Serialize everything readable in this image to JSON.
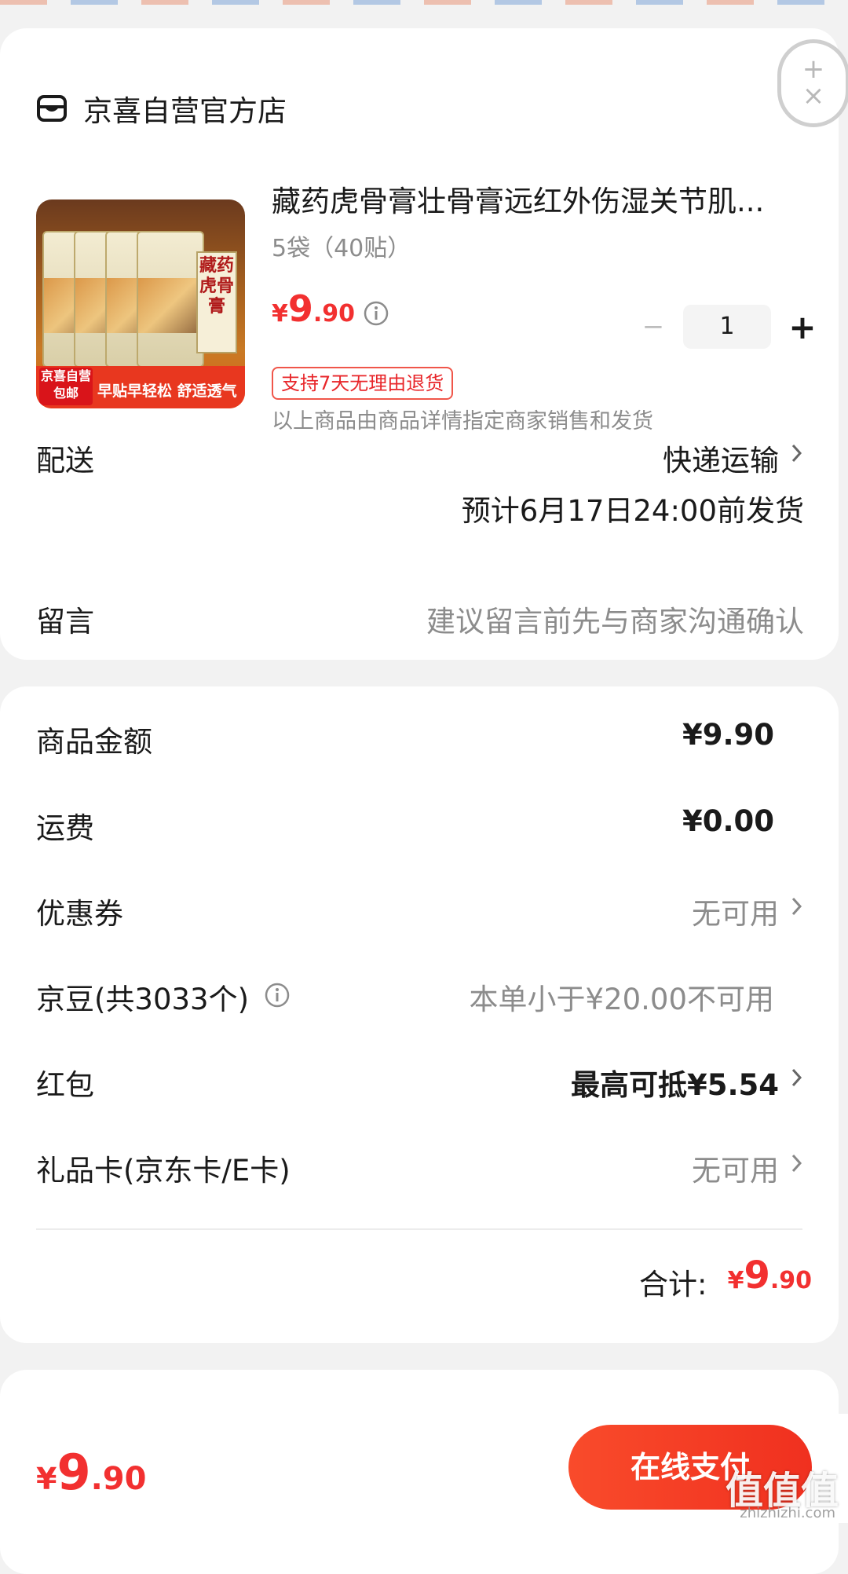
{
  "shop": {
    "name": "京喜自营官方店",
    "icon": "shop-icon"
  },
  "product": {
    "title": "藏药虎骨膏壮骨膏远红外伤湿关节肌...",
    "spec": "5袋（40贴）",
    "price_symbol": "¥",
    "price_int": "9",
    "price_dec": ".90",
    "quantity": "1",
    "minus_label": "−",
    "plus_label": "+",
    "return_badge": "支持7天无理由退货",
    "seller_note": "以上商品由商品详情指定商家销售和发货",
    "image": {
      "pouch_label": "藏药虎骨膏",
      "tag_main": "京喜自营包邮",
      "tag_text": "早贴早轻松 舒适透气"
    }
  },
  "delivery": {
    "label": "配送",
    "method": "快递运输",
    "eta": "预计6月17日24:00前发货"
  },
  "message": {
    "label": "留言",
    "placeholder": "建议留言前先与商家沟通确认"
  },
  "summary": {
    "goods_label": "商品金额",
    "goods_value": "¥9.90",
    "shipping_label": "运费",
    "shipping_value": "¥0.00",
    "coupon_label": "优惠券",
    "coupon_value": "无可用",
    "beans_label": "京豆(共3033个)",
    "beans_value": "本单小于¥20.00不可用",
    "redpacket_label": "红包",
    "redpacket_value": "最高可抵¥5.54",
    "giftcard_label": "礼品卡(京东卡/E卡)",
    "giftcard_value": "无可用",
    "total_label": "合计:",
    "total_symbol": "¥",
    "total_int": "9",
    "total_dec": ".90"
  },
  "bottom": {
    "price_symbol": "¥",
    "price_int": "9",
    "price_dec": ".90",
    "pay_label": "在线支付",
    "watermark": "值值值",
    "watermark_url": "zhizhizhi.com"
  },
  "colors": {
    "accent": "#f23030",
    "button": "#f0301f",
    "muted": "#8c8c8c"
  }
}
